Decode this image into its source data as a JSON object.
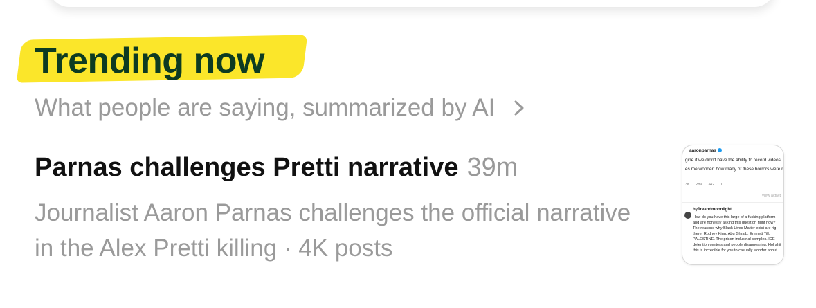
{
  "section": {
    "title": "Trending now",
    "subtitle": "What people are saying, summarized by AI",
    "highlight_color": "#fbe62a",
    "title_color": "#0d3b22"
  },
  "story": {
    "title": "Parnas challenges Pretti narrative",
    "time": "39m",
    "description": "Journalist Aaron Parnas challenges the official narrative in the Alex Pretti killing · 4K posts"
  },
  "thumbnail": {
    "username": "aaronparnas",
    "line1": "gine if we didn't have the ability to record videos.",
    "line2": "es me wonder: how many of these horrors were nev ed?",
    "stats": [
      "3K",
      "289",
      "342",
      "1"
    ],
    "view_activity": "View activit",
    "reply_user": "byfireandmoonlight",
    "reply_text": "How do you have this large of a fucking platform and are honestly asking this question right now? The reasons why Black Lives Matter exist are rig there. Rodney King. Abu Ghraib. Emmett Till. PALESTINE. The prison industrial complex. ICE detention centers and people disappearing. Hol shit this is incredible for you to casually wonder about."
  },
  "icons": {
    "subtitle_chevron": "chevron-right-icon"
  }
}
